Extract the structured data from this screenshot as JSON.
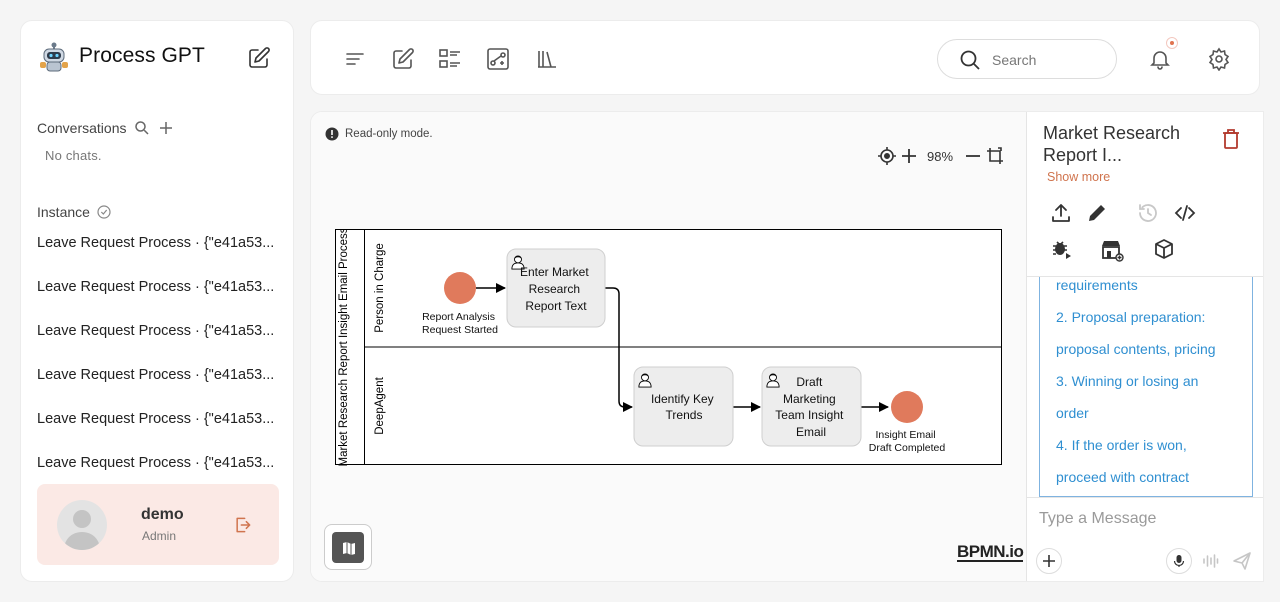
{
  "app": {
    "title": "Process GPT"
  },
  "sidebar": {
    "conversations_label": "Conversations",
    "no_chats": "No chats.",
    "instance_label": "Instance",
    "instances": [
      "Leave Request Process · {\"e41a53...",
      "Leave Request Process · {\"e41a53...",
      "Leave Request Process · {\"e41a53...",
      "Leave Request Process · {\"e41a53...",
      "Leave Request Process · {\"e41a53...",
      "Leave Request Process · {\"e41a53..."
    ],
    "user": {
      "name": "demo",
      "role": "Admin"
    }
  },
  "topbar": {
    "search_placeholder": "Search",
    "icons": [
      "menu-icon",
      "edit-icon",
      "list-icon",
      "process-map-icon",
      "library-icon",
      "bell-icon",
      "gear-icon"
    ]
  },
  "canvas": {
    "readonly_text": "Read-only mode.",
    "zoom": "98%",
    "logo": "BPMN.io"
  },
  "diagram": {
    "pool": "Market Research Report Insight Email Process",
    "lanes": [
      "Person in Charge",
      "DeepAgent"
    ],
    "start_event": [
      "Report Analysis",
      "Request Started"
    ],
    "task1": [
      "Enter Market",
      "Research",
      "Report Text"
    ],
    "task2": [
      "Identify Key",
      "Trends"
    ],
    "task3": [
      "Draft",
      "Marketing",
      "Team Insight",
      "Email"
    ],
    "end_event": [
      "Insight Email",
      "Draft Completed"
    ]
  },
  "panel": {
    "title": "Market Research Report I...",
    "show_more": "Show more",
    "steps": [
      "requirements",
      "2. Proposal preparation:",
      "proposal contents, pricing",
      "3. Winning or losing an",
      "order",
      "4. If the order is won,",
      "proceed with contract"
    ],
    "message_placeholder": "Type a Message"
  },
  "colors": {
    "accent": "#d0744e",
    "event": "#e07a5c",
    "link": "#2f8fd1",
    "user_card": "#fbe9e5"
  }
}
